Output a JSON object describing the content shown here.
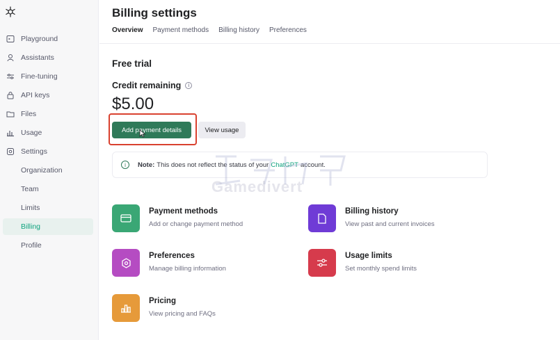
{
  "sidebar": {
    "items": [
      {
        "label": "Playground",
        "icon": "terminal-icon"
      },
      {
        "label": "Assistants",
        "icon": "robot-icon"
      },
      {
        "label": "Fine-tuning",
        "icon": "sliders-icon"
      },
      {
        "label": "API keys",
        "icon": "lock-icon"
      },
      {
        "label": "Files",
        "icon": "folder-icon"
      },
      {
        "label": "Usage",
        "icon": "bar-chart-icon"
      },
      {
        "label": "Settings",
        "icon": "gear-icon"
      }
    ],
    "sub_items": [
      {
        "label": "Organization"
      },
      {
        "label": "Team"
      },
      {
        "label": "Limits"
      },
      {
        "label": "Billing",
        "active": true
      },
      {
        "label": "Profile"
      }
    ]
  },
  "header": {
    "title": "Billing settings",
    "tabs": [
      {
        "label": "Overview",
        "active": true
      },
      {
        "label": "Payment methods"
      },
      {
        "label": "Billing history"
      },
      {
        "label": "Preferences"
      }
    ]
  },
  "overview": {
    "plan": "Free trial",
    "credit_label": "Credit remaining",
    "credit_amount": "$5.00",
    "primary_button": "Add payment details",
    "secondary_button": "View usage",
    "note": {
      "bold": "Note:",
      "text_before": "This does not reflect the status of your",
      "link": "ChatGPT",
      "text_after": "account."
    }
  },
  "cards": [
    {
      "title": "Payment methods",
      "desc": "Add or change payment method",
      "color": "#3aa775",
      "icon": "credit-card-icon"
    },
    {
      "title": "Billing history",
      "desc": "View past and current invoices",
      "color": "#6f3bd6",
      "icon": "document-icon"
    },
    {
      "title": "Preferences",
      "desc": "Manage billing information",
      "color": "#b54cc2",
      "icon": "settings-icon"
    },
    {
      "title": "Usage limits",
      "desc": "Set monthly spend limits",
      "color": "#d63b4c",
      "icon": "sliders-icon"
    },
    {
      "title": "Pricing",
      "desc": "View pricing and FAQs",
      "color": "#e69a3a",
      "icon": "chart-icon"
    }
  ],
  "watermark": {
    "text": "Gamedivert"
  },
  "colors": {
    "accent": "#10a37f",
    "primary_button": "#2f7a59",
    "highlight": "#d9412f"
  }
}
